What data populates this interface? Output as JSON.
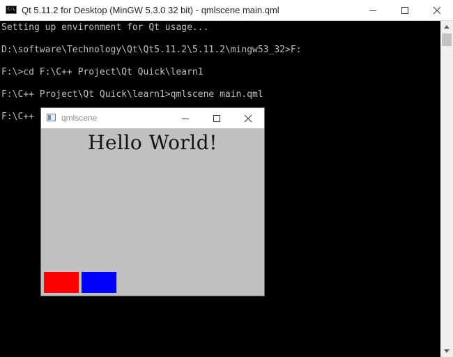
{
  "console": {
    "title": "Qt 5.11.2 for Desktop (MinGW 5.3.0 32 bit) - qmlscene  main.qml",
    "icon": "console-icon",
    "icon_text": "C:\\",
    "lines": [
      "Setting up environment for Qt usage...",
      "",
      "D:\\software\\Technology\\Qt\\Qt5.11.2\\5.11.2\\mingw53_32>F:",
      "",
      "F:\\>cd F:\\C++ Project\\Qt Quick\\learn1",
      "",
      "F:\\C++ Project\\Qt Quick\\learn1>qmlscene main.qml",
      "",
      "F:\\C++ Project\\Qt Quick\\learn1"
    ]
  },
  "qml_window": {
    "title": "qmlscene",
    "hello_text": "Hello World!",
    "red_color": "#ff0000",
    "blue_color": "#0000ff",
    "background": "#c0c0c0"
  },
  "colors": {
    "terminal_bg": "#000000",
    "terminal_fg": "#c0c0c0"
  }
}
